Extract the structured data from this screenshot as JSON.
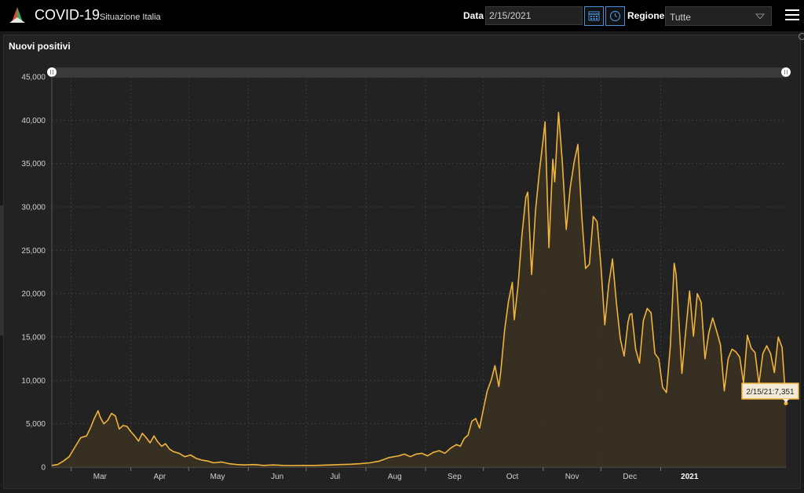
{
  "app": {
    "title": "COVID-19",
    "subtitle": "Situazione Italia"
  },
  "filters": {
    "date_label": "Data",
    "date_value": "2/15/2021",
    "region_label": "Regione",
    "region_value": "Tutte"
  },
  "icons": {
    "logo": "covid-logo-icon",
    "calendar": "calendar-icon",
    "clock": "clock-icon",
    "dropdown": "chevron-down-icon",
    "menu": "hamburger-menu-icon"
  },
  "colors": {
    "line": "#f0b43c",
    "fill": "#3a3122",
    "accent": "#4a90d9",
    "tooltip_bg": "#f4ead8",
    "tooltip_border": "#f0b43c"
  },
  "panel": {
    "title": "Nuovi positivi"
  },
  "chart_data": {
    "type": "area",
    "title": "Nuovi positivi",
    "xlabel": "",
    "ylabel": "",
    "ylim": [
      0,
      45000
    ],
    "grid": true,
    "legend": "none",
    "y_ticks": [
      "0",
      "5,000",
      "10,000",
      "15,000",
      "20,000",
      "25,000",
      "30,000",
      "35,000",
      "40,000",
      "45,000"
    ],
    "x_tick_labels": [
      {
        "label": "Mar",
        "day": 10,
        "bold": false
      },
      {
        "label": "Apr",
        "day": 41,
        "bold": false
      },
      {
        "label": "May",
        "day": 71,
        "bold": false
      },
      {
        "label": "Jun",
        "day": 102,
        "bold": false
      },
      {
        "label": "Jul",
        "day": 132,
        "bold": false
      },
      {
        "label": "Aug",
        "day": 163,
        "bold": false
      },
      {
        "label": "Sep",
        "day": 194,
        "bold": false
      },
      {
        "label": "Oct",
        "day": 224,
        "bold": false
      },
      {
        "label": "Nov",
        "day": 255,
        "bold": false
      },
      {
        "label": "Dec",
        "day": 285,
        "bold": false
      },
      {
        "label": "2021",
        "day": 316,
        "bold": true
      }
    ],
    "start_date": "2020-02-24",
    "end_date": "2021-02-15",
    "series": [
      {
        "name": "Nuovi positivi",
        "points": [
          [
            0,
            200
          ],
          [
            3,
            300
          ],
          [
            6,
            700
          ],
          [
            9,
            1200
          ],
          [
            12,
            2300
          ],
          [
            15,
            3400
          ],
          [
            18,
            3600
          ],
          [
            20,
            4500
          ],
          [
            22,
            5600
          ],
          [
            24,
            6500
          ],
          [
            25,
            5800
          ],
          [
            27,
            5000
          ],
          [
            29,
            5400
          ],
          [
            31,
            6200
          ],
          [
            33,
            5900
          ],
          [
            35,
            4400
          ],
          [
            37,
            4800
          ],
          [
            39,
            4700
          ],
          [
            41,
            4100
          ],
          [
            43,
            3600
          ],
          [
            45,
            3000
          ],
          [
            47,
            3900
          ],
          [
            49,
            3400
          ],
          [
            51,
            2800
          ],
          [
            53,
            3600
          ],
          [
            55,
            2900
          ],
          [
            57,
            2400
          ],
          [
            59,
            2700
          ],
          [
            61,
            2100
          ],
          [
            63,
            1800
          ],
          [
            66,
            1600
          ],
          [
            69,
            1200
          ],
          [
            72,
            1400
          ],
          [
            75,
            1000
          ],
          [
            78,
            800
          ],
          [
            81,
            700
          ],
          [
            84,
            500
          ],
          [
            88,
            600
          ],
          [
            92,
            400
          ],
          [
            96,
            300
          ],
          [
            100,
            250
          ],
          [
            105,
            300
          ],
          [
            110,
            200
          ],
          [
            115,
            250
          ],
          [
            120,
            200
          ],
          [
            125,
            180
          ],
          [
            130,
            200
          ],
          [
            135,
            190
          ],
          [
            140,
            220
          ],
          [
            145,
            250
          ],
          [
            150,
            300
          ],
          [
            155,
            330
          ],
          [
            160,
            400
          ],
          [
            165,
            500
          ],
          [
            170,
            700
          ],
          [
            175,
            1100
          ],
          [
            180,
            1300
          ],
          [
            183,
            1500
          ],
          [
            186,
            1200
          ],
          [
            189,
            1500
          ],
          [
            192,
            1600
          ],
          [
            195,
            1300
          ],
          [
            198,
            1700
          ],
          [
            201,
            1900
          ],
          [
            204,
            1600
          ],
          [
            207,
            2200
          ],
          [
            210,
            2600
          ],
          [
            212,
            2400
          ],
          [
            214,
            3300
          ],
          [
            216,
            3700
          ],
          [
            218,
            5300
          ],
          [
            220,
            5600
          ],
          [
            222,
            4500
          ],
          [
            224,
            6700
          ],
          [
            226,
            8800
          ],
          [
            228,
            10000
          ],
          [
            230,
            11700
          ],
          [
            232,
            9300
          ],
          [
            233,
            11000
          ],
          [
            235,
            15800
          ],
          [
            237,
            19100
          ],
          [
            239,
            21300
          ],
          [
            240,
            17000
          ],
          [
            242,
            21000
          ],
          [
            244,
            26800
          ],
          [
            246,
            31100
          ],
          [
            247,
            31700
          ],
          [
            249,
            22200
          ],
          [
            251,
            29500
          ],
          [
            253,
            34000
          ],
          [
            255,
            37800
          ],
          [
            256,
            39800
          ],
          [
            258,
            25300
          ],
          [
            260,
            35500
          ],
          [
            261,
            32900
          ],
          [
            263,
            40900
          ],
          [
            265,
            35000
          ],
          [
            267,
            27400
          ],
          [
            269,
            32100
          ],
          [
            271,
            35100
          ],
          [
            273,
            37200
          ],
          [
            275,
            29000
          ],
          [
            277,
            22900
          ],
          [
            279,
            23400
          ],
          [
            281,
            28900
          ],
          [
            283,
            28300
          ],
          [
            285,
            23200
          ],
          [
            287,
            16400
          ],
          [
            289,
            21000
          ],
          [
            291,
            24000
          ],
          [
            293,
            19000
          ],
          [
            295,
            14800
          ],
          [
            297,
            12800
          ],
          [
            299,
            16700
          ],
          [
            300,
            17600
          ],
          [
            301,
            17700
          ],
          [
            303,
            13600
          ],
          [
            305,
            12000
          ],
          [
            307,
            16900
          ],
          [
            309,
            18300
          ],
          [
            311,
            17800
          ],
          [
            313,
            13100
          ],
          [
            315,
            12500
          ],
          [
            317,
            9200
          ],
          [
            319,
            8600
          ],
          [
            321,
            14000
          ],
          [
            323,
            23500
          ],
          [
            324,
            22200
          ],
          [
            325,
            18600
          ],
          [
            327,
            10800
          ],
          [
            329,
            15700
          ],
          [
            331,
            20300
          ],
          [
            333,
            15100
          ],
          [
            335,
            20000
          ],
          [
            337,
            19000
          ],
          [
            339,
            12500
          ],
          [
            341,
            15500
          ],
          [
            343,
            17200
          ],
          [
            345,
            15700
          ],
          [
            347,
            14100
          ],
          [
            349,
            8800
          ],
          [
            351,
            12500
          ],
          [
            353,
            13600
          ],
          [
            355,
            13300
          ],
          [
            357,
            12700
          ],
          [
            359,
            9700
          ],
          [
            361,
            15200
          ],
          [
            363,
            13700
          ],
          [
            365,
            13200
          ],
          [
            367,
            9600
          ],
          [
            369,
            13100
          ],
          [
            371,
            14000
          ],
          [
            373,
            13100
          ],
          [
            375,
            10900
          ],
          [
            377,
            15000
          ],
          [
            379,
            13800
          ],
          [
            381,
            7351
          ]
        ]
      }
    ],
    "tooltip": "2/15/21:7,351"
  }
}
